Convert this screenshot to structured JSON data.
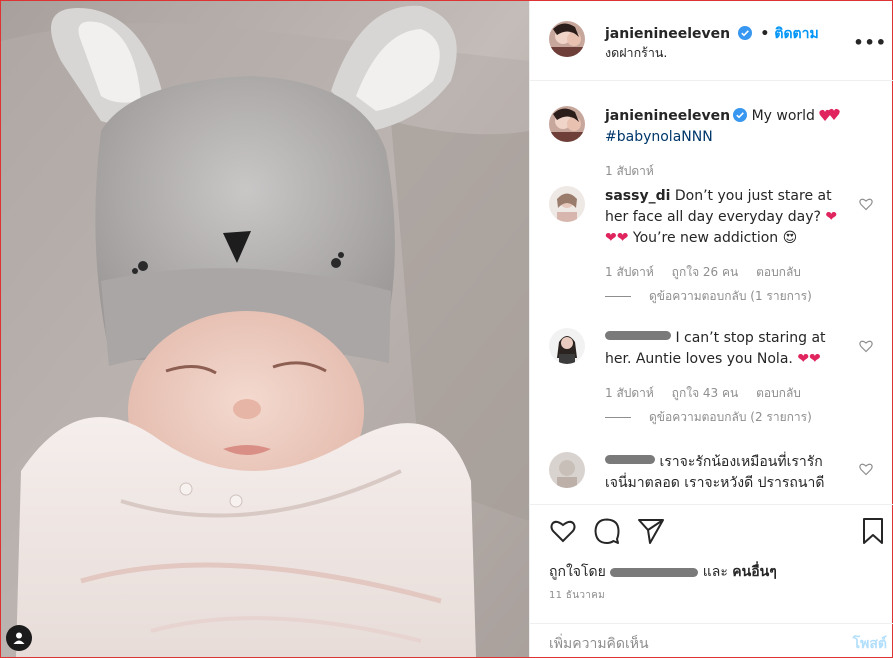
{
  "post": {
    "username": "janienineeleven",
    "follow_label": "ติดตาม",
    "follow_sep": "•",
    "location": "งดฝากร้าน.",
    "caption_text": "My world",
    "caption_tag": "#babynolaNNN",
    "caption_time": "1 สัปดาห์",
    "more_label": "•••"
  },
  "comments": [
    {
      "username": "sassy_di",
      "text": "Don’t you just stare at her face all day everyday day? ❤️❤️❤️ You’re new addiction 😍",
      "line1": "Don’t you just stare at",
      "line2": "her face all day everyday day?",
      "line3": "You’re new addiction",
      "time": "1 สัปดาห์",
      "likes": "ถูกใจ 26 คน",
      "reply": "ตอบกลับ",
      "view_replies": "ดูข้อความตอบกลับ (1 รายการ)"
    },
    {
      "username": "",
      "line1": "I can’t stop staring at",
      "line2": "her. Auntie loves you Nola.",
      "time": "1 สัปดาห์",
      "likes": "ถูกใจ 43 คน",
      "reply": "ตอบกลับ",
      "view_replies": "ดูข้อความตอบกลับ (2 รายการ)"
    },
    {
      "username": "",
      "line1": "เราจะรักน้องเหมือนที่เรารัก",
      "line2": "เจนี่มาตลอด เราจะหวังดี ปรารถนาดี"
    }
  ],
  "actions": {
    "liked_by_prefix": "ถูกใจโดย",
    "liked_by_and": "และ",
    "liked_by_others": "คนอื่นๆ",
    "date": "11 ธันวาคม"
  },
  "add_comment": {
    "placeholder": "เพิ่มความคิดเห็น",
    "post_label": "โพสต์"
  },
  "icons": [
    "verified-badge-icon",
    "heart-icon",
    "comment-icon",
    "share-icon",
    "bookmark-icon",
    "more-options-icon",
    "user-tag-icon"
  ],
  "colors": {
    "accent": "#0095f6",
    "text": "#262626",
    "muted": "#8e8e8e",
    "heart_red": "#e0245e"
  }
}
